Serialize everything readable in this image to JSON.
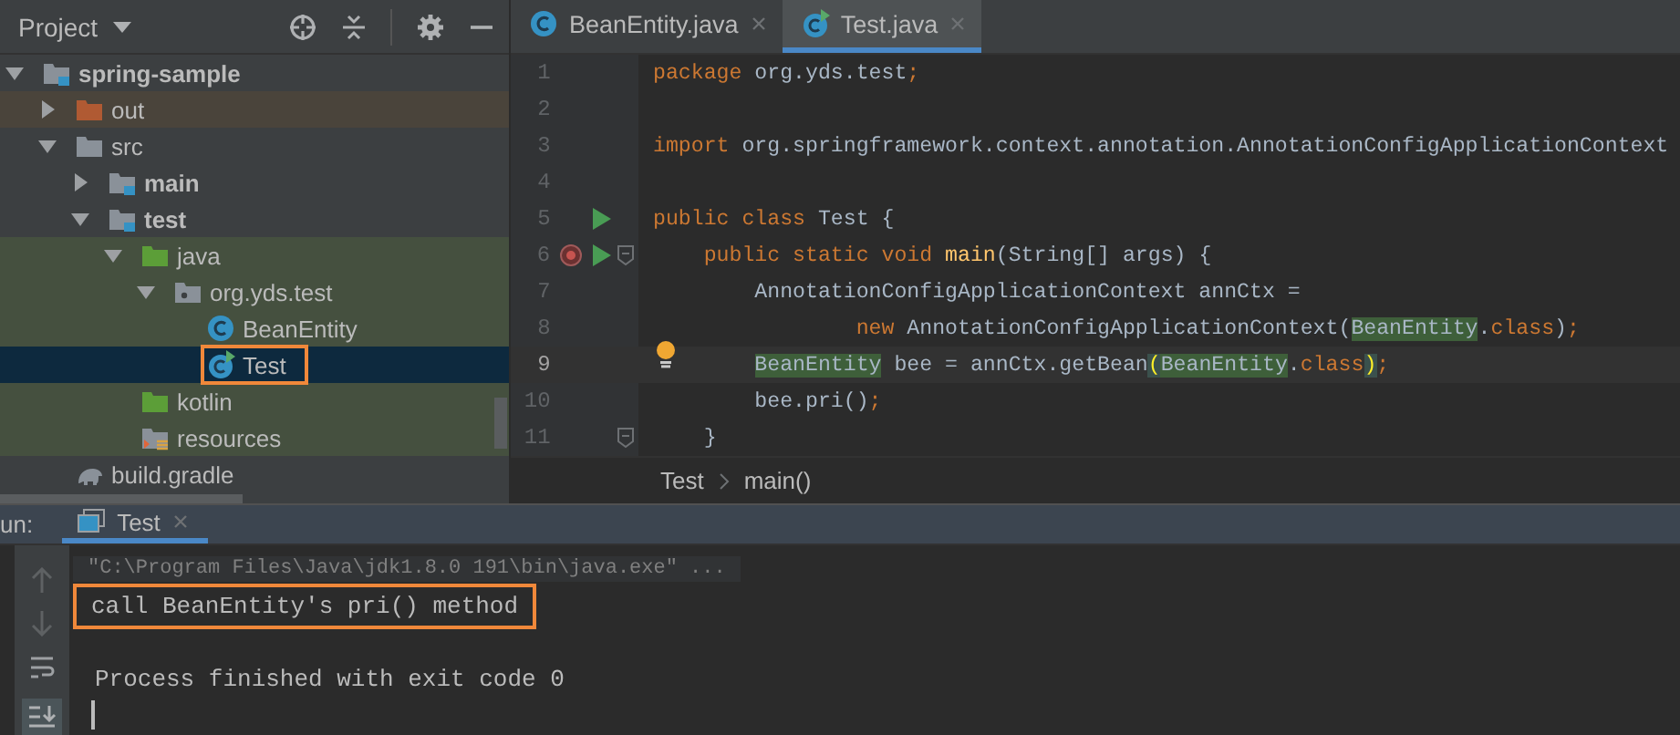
{
  "project_panel": {
    "title": "Project",
    "tree": [
      {
        "label": "spring-sample",
        "kind": "module",
        "bold": true,
        "expanded": true,
        "selected": false,
        "children": [
          {
            "label": "out",
            "kind": "excluded-folder",
            "expanded": false,
            "color": "#4a443b",
            "selected": false
          },
          {
            "label": "src",
            "kind": "folder",
            "expanded": true,
            "selected": false,
            "children": [
              {
                "label": "main",
                "kind": "module",
                "bold": true,
                "expanded": false,
                "selected": false
              },
              {
                "label": "test",
                "kind": "module",
                "bold": true,
                "expanded": true,
                "selected": false,
                "children": [
                  {
                    "label": "java",
                    "kind": "source-folder",
                    "expanded": true,
                    "color": "#45503f",
                    "selected": false,
                    "children": [
                      {
                        "label": "org.yds.test",
                        "kind": "package",
                        "expanded": true,
                        "color": "#45503f",
                        "selected": false,
                        "children": [
                          {
                            "label": "BeanEntity",
                            "kind": "class",
                            "color": "#45503f",
                            "selected": false
                          },
                          {
                            "label": "Test",
                            "kind": "test-class",
                            "selected": true,
                            "outlined": true
                          }
                        ]
                      }
                    ]
                  },
                  {
                    "label": "kotlin",
                    "kind": "source-folder",
                    "color": "#45503f",
                    "selected": false
                  },
                  {
                    "label": "resources",
                    "kind": "resources",
                    "color": "#45503f",
                    "selected": false
                  }
                ]
              }
            ]
          },
          {
            "label": "build.gradle",
            "kind": "gradle",
            "selected": false
          }
        ]
      }
    ]
  },
  "editor": {
    "tabs": [
      {
        "label": "BeanEntity.java",
        "kind": "class",
        "selected": false
      },
      {
        "label": "Test.java",
        "kind": "test-class",
        "selected": true
      }
    ],
    "lines": [
      {
        "number": "1",
        "tokens": [
          {
            "kind": "keyword",
            "text": "package"
          },
          {
            "kind": "plain",
            "text": " org.yds.test"
          },
          {
            "kind": "keyword",
            "text": ";"
          }
        ]
      },
      {
        "number": "2"
      },
      {
        "number": "3",
        "tokens": [
          {
            "kind": "keyword",
            "text": "import"
          },
          {
            "kind": "plain",
            "text": " org.springframework.context.annotation.AnnotationConfigApplicationContext"
          }
        ]
      },
      {
        "number": "4"
      },
      {
        "number": "5",
        "run": true,
        "tokens": [
          {
            "kind": "keyword",
            "text": "public class "
          },
          {
            "kind": "plain",
            "text": "Test {"
          }
        ]
      },
      {
        "number": "6",
        "breakpoint": true,
        "run": true,
        "fold": true,
        "tokens": [
          {
            "kind": "keyword",
            "text": "    public static void "
          },
          {
            "kind": "method",
            "text": "main"
          },
          {
            "kind": "plain",
            "text": "(String[] args) {"
          }
        ]
      },
      {
        "number": "7",
        "tokens": [
          {
            "kind": "plain",
            "text": "        AnnotationConfigApplicationContext annCtx ="
          }
        ]
      },
      {
        "number": "8",
        "tokens": [
          {
            "kind": "keyword",
            "text": "                new "
          },
          {
            "kind": "plain",
            "text": "AnnotationConfigApplicationContext("
          },
          {
            "kind": "usage",
            "text": "BeanEntity"
          },
          {
            "kind": "plain",
            "text": "."
          },
          {
            "kind": "keyword",
            "text": "class"
          },
          {
            "kind": "plain",
            "text": ")"
          },
          {
            "kind": "keyword",
            "text": ";"
          }
        ]
      },
      {
        "number": "9",
        "current": true,
        "bulb": true,
        "tokens": [
          {
            "kind": "usage",
            "text": "        BeanEntity"
          },
          {
            "kind": "plain",
            "text": " bee = annCtx.getBean"
          },
          {
            "kind": "brace",
            "text": "("
          },
          {
            "kind": "usage",
            "text": "BeanEntity"
          },
          {
            "kind": "plain",
            "text": "."
          },
          {
            "kind": "keyword",
            "text": "class"
          },
          {
            "kind": "brace",
            "text": ")"
          },
          {
            "kind": "keyword",
            "text": ";"
          }
        ]
      },
      {
        "number": "10",
        "tokens": [
          {
            "kind": "plain",
            "text": "        bee.pri()"
          },
          {
            "kind": "keyword",
            "text": ";"
          }
        ]
      },
      {
        "number": "11",
        "fold": true,
        "tokens": [
          {
            "kind": "plain",
            "text": "    }"
          }
        ]
      }
    ],
    "breadcrumb": [
      "Test",
      "main()"
    ]
  },
  "run_panel": {
    "label": "un:",
    "tabs": [
      {
        "label": "Test",
        "selected": true
      }
    ],
    "console": [
      {
        "kind": "command",
        "text": "\"C:\\Program Files\\Java\\jdk1.8.0 191\\bin\\java.exe\" ..."
      },
      {
        "kind": "output",
        "text": "call BeanEntity's pri() method",
        "outlined": true
      },
      {
        "kind": "blank"
      },
      {
        "kind": "output",
        "text": "Process finished with exit code 0"
      },
      {
        "kind": "caret"
      }
    ]
  }
}
